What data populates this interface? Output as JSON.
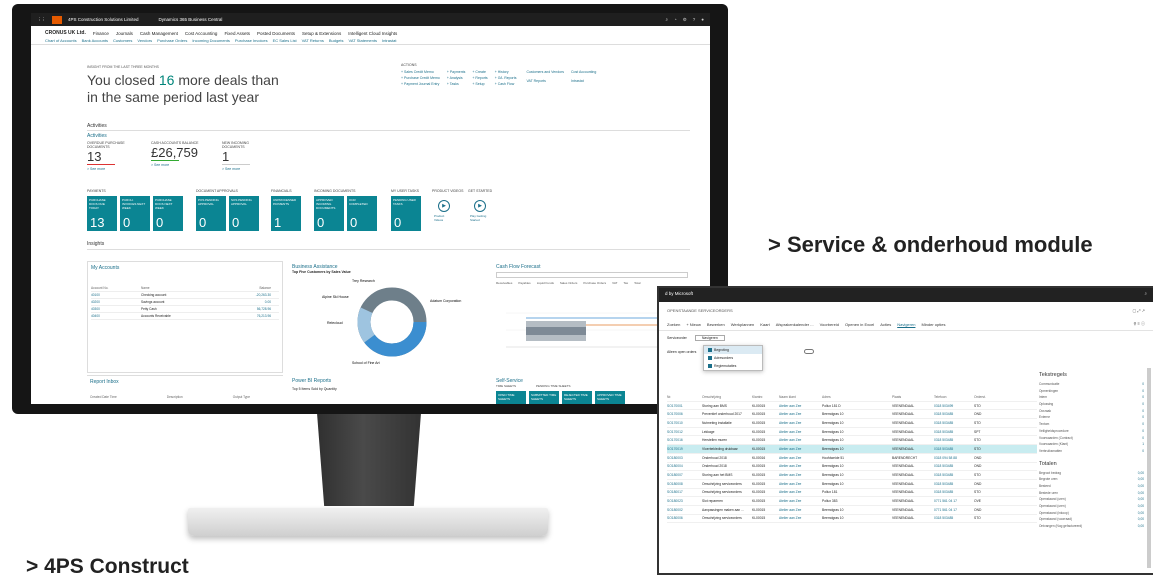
{
  "captions": {
    "service": "> Service & onderhoud module",
    "construct": "> 4PS Construct"
  },
  "bc": {
    "topbar": {
      "org": "4PS Construction Solutions Limited",
      "app_title": "Dynamics 365 Business Central",
      "icons": [
        "search-icon",
        "bell-icon",
        "gear-icon",
        "help-icon",
        "user-icon"
      ]
    },
    "company": "CRONUS UK Ltd.",
    "menu": [
      "Finance",
      "Journals",
      "Cash Management",
      "Cost Accounting",
      "Fixed Assets",
      "Posted Documents",
      "Setup & Extensions",
      "Intelligent Cloud Insights"
    ],
    "subnav": [
      "Chart of Accounts",
      "Bank Accounts",
      "Customers",
      "Vendors",
      "Purchase Orders",
      "Incoming Documents",
      "Purchase Invoices",
      "EC Sales List",
      "VAT Returns",
      "Budgets",
      "VAT Statements",
      "Intrastat"
    ],
    "headline": {
      "eyebrow": "INSIGHT FROM THE LAST THREE MONTHS",
      "pre": "You closed",
      "number": "16",
      "post": "more deals than in the same period last year"
    },
    "actions": {
      "label": "ACTIONS",
      "items": [
        "+ Sales Credit Memo",
        "+ Payments",
        "+ Create",
        "+ History",
        "+ Purchase Credit Memo",
        "+ Analysis",
        "+ Reports",
        "+ G/L Reports",
        "+ Payment Journal Entry",
        "+ Tasks",
        "+ Setup",
        "+ Cash Flow"
      ],
      "links": [
        "Customers and Vendors",
        "Cost Accounting",
        "VAT Reports",
        "Intrastat"
      ]
    },
    "activities": {
      "section": "Activities",
      "group": "Activities",
      "cues": [
        {
          "label": "OVERDUE PURCHASE DOCUMENTS",
          "value": "13",
          "link": "> See more"
        },
        {
          "label": "CASH ACCOUNTS BALANCE",
          "value": "£26,759",
          "link": "> See more"
        },
        {
          "label": "NEW INCOMING DOCUMENTS",
          "value": "1",
          "link": "> See more"
        }
      ]
    },
    "tile_groups": [
      {
        "label": "PAYMENTS",
        "tiles": [
          {
            "label": "PURCHASE DOCS DUE TODAY",
            "value": "13"
          },
          {
            "label": "PURCH. INVOICES NEXT WEEK",
            "value": "0"
          },
          {
            "label": "PURCHASE DOCS NEXT WEEK",
            "value": "0"
          }
        ]
      },
      {
        "label": "DOCUMENT APPROVALS",
        "tiles": [
          {
            "label": "POS PENDING APPROVAL",
            "value": "0"
          },
          {
            "label": "SOS PENDING APPROVAL",
            "value": "0"
          }
        ]
      },
      {
        "label": "FINANCIALS",
        "tiles": [
          {
            "label": "UNPROCESSED PAYMENTS",
            "value": "1"
          }
        ]
      },
      {
        "label": "INCOMING DOCUMENTS",
        "tiles": [
          {
            "label": "APPROVED INCOMING DOCUMENTS",
            "value": "0"
          },
          {
            "label": "OCR COMPLETED",
            "value": "0"
          }
        ]
      },
      {
        "label": "MY USER TASKS",
        "tiles": [
          {
            "label": "PENDING USER TASKS",
            "value": "0"
          }
        ]
      }
    ],
    "videos": {
      "label": "PRODUCT VIDEOS",
      "tile": "Product Videos"
    },
    "get_started": {
      "label": "GET STARTED",
      "tile": "Play Getting Started"
    },
    "insights": "Insights",
    "my_accounts": {
      "title": "My Accounts",
      "headers": [
        "Account No.",
        "Name",
        "Balance"
      ],
      "rows": [
        [
          "40100",
          "Checking account",
          "-20,263.30"
        ],
        [
          "40200",
          "Savings account",
          "0.00"
        ],
        [
          "40300",
          "Petty Cash",
          "56,728.96"
        ],
        [
          "40400",
          "Accounts Receivable",
          "76,213.96"
        ]
      ]
    },
    "business_assistance": {
      "title": "Business Assistance",
      "subtitle": "Top Five Customers by Sales Value",
      "labels": [
        "Trey Research",
        "Adatum Corporation",
        "Alpine Ski House",
        "Relecloud",
        "School of Fine Art"
      ]
    },
    "cash_flow": {
      "title": "Cash Flow Forecast",
      "legend": [
        "Receivables",
        "Payables",
        "Liquid Funds",
        "Sales Orders",
        "Purchase Orders",
        "VAT",
        "Tax",
        "Total"
      ]
    },
    "report_inbox": {
      "title": "Report Inbox",
      "headers": [
        "Created Date Time",
        "Description",
        "Output Type"
      ]
    },
    "power_bi": {
      "title": "Power BI Reports",
      "subtitle": "Top 5 Items Sold by Quantity"
    },
    "self_service": {
      "title": "Self-Service",
      "labels": [
        "TIME SHEETS",
        "PENDING TIME SHEETS"
      ],
      "tiles": [
        {
          "label": "OPEN TIME SHEETS",
          "value": "0"
        },
        {
          "label": "SUBMITTED TIME SHEETS",
          "value": "0"
        },
        {
          "label": "REJECTED TIME SHEETS",
          "value": "0"
        },
        {
          "label": "APPROVED TIME SHEETS",
          "value": "0"
        }
      ]
    }
  },
  "service": {
    "topbar": "d by Microsoft",
    "title": "OPENSTAANDE SERVICEORDERS",
    "toolbar": [
      "Zoeken",
      "+ Nieuw",
      "Bewerken",
      "Werkplannen",
      "Kaart",
      "Afsprakenkalender ...",
      "Voorbereid",
      "Openen in Excel",
      "Acties",
      "Navigeren",
      "Minder opties"
    ],
    "filter_label": "Serviceorder",
    "filter_value": "Navigeren",
    "filter2": "Alleen open orders",
    "dropdown": [
      "Begroting",
      "Adresorders",
      "Regiemutaties"
    ],
    "headers": [
      "Nr.",
      "Omschrijving",
      "Klantnr.",
      "Naam klant",
      "Adres",
      "Plaats",
      "Telefoon",
      "Orderst."
    ],
    "rows": [
      [
        "SO170001",
        "Storing aan BMS",
        "KL00015",
        "Atelier aan Zee",
        "Pollux 181 D",
        "VEENENDAAL",
        "0318 503499",
        "STO"
      ],
      [
        "SO170006",
        "Preventief onderhoud 2017",
        "KL00015",
        "Atelier aan Zee",
        "Beemdgras 10",
        "VEENENDAAL",
        "0318 503485",
        "OND"
      ],
      [
        "SO170010",
        "Nutmeting installatie",
        "KL00015",
        "Atelier aan Zee",
        "Beemdgras 10",
        "VEENENDAAL",
        "0318 503485",
        "STO"
      ],
      [
        "SO170012",
        "Lekkage",
        "KL00015",
        "Atelier aan Zee",
        "Beemdgras 10",
        "VEENENDAAL",
        "0318 503485",
        "SPT"
      ],
      [
        "SO170016",
        "Herstellen muren",
        "KL00015",
        "Atelier aan Zee",
        "Beemdgras 10",
        "VEENENDAAL",
        "0318 503485",
        "STO"
      ],
      [
        "SO170019",
        "Vloerbekleding drukbaar",
        "KL00015",
        "Atelier aan Zee",
        "Beemdgras 10",
        "VEENENDAAL",
        "0318 503485",
        "STO"
      ],
      [
        "SO180003",
        "Onderhoud 2018",
        "KL00016",
        "Atelier aan Zee",
        "Hoofdweide 51",
        "BARENDRECHT",
        "0318 094 58 88",
        "OND"
      ],
      [
        "SO180004",
        "Onderhoud 2018",
        "KL00015",
        "Atelier aan Zee",
        "Beemdgras 10",
        "VEENENDAAL",
        "0318 503485",
        "OND"
      ],
      [
        "SO180007",
        "Storing aan het BMS",
        "KL00015",
        "Atelier aan Zee",
        "Beemdgras 10",
        "VEENENDAAL",
        "0318 503485",
        "STO"
      ],
      [
        "SO180008",
        "Omschrijving serviceorders",
        "KL00015",
        "Atelier aan Zee",
        "Beemdgras 10",
        "VEENENDAAL",
        "0318 503485",
        "OND"
      ],
      [
        "SO180017",
        "Omschrijving serviceorders",
        "KL00015",
        "Atelier aan Zee",
        "Pollux 181",
        "VEENENDAAL",
        "0318 503485",
        "STO"
      ],
      [
        "SO180023",
        "Slot repareren",
        "KL00015",
        "Atelier aan Zee",
        "Pollux 383",
        "VEENENDAAL",
        "0771 561 04 17",
        "OVE"
      ],
      [
        "SO180002",
        "Aanpassingen maken aan ...",
        "KL00015",
        "Atelier aan Zee",
        "Beemdgras 10",
        "VEENENDAAL",
        "0771 561 04 17",
        "OND"
      ],
      [
        "SO180006",
        "Omschrijving serviceorders",
        "KL00015",
        "Atelier aan Zee",
        "Beemdgras 10",
        "VEENENDAAL",
        "0318 503485",
        "STO"
      ]
    ],
    "highlighted_row": 5,
    "factbox": {
      "title1": "Tekstregels",
      "rows1": [
        [
          "Communicatie",
          "0"
        ],
        [
          "Opmerkingen",
          "0"
        ],
        [
          "Intern",
          "0"
        ],
        [
          "Oplossing",
          "0"
        ],
        [
          "Oorzaak",
          "0"
        ],
        [
          "Externe",
          "0"
        ],
        [
          "Textom",
          "0"
        ],
        [
          "Veiligheidsprocedure",
          "0"
        ],
        [
          "Voorwaarden (Contract)",
          "0"
        ],
        [
          "Voorwaarden (Klant)",
          "1"
        ],
        [
          "Verbruiksmatten",
          "0"
        ]
      ],
      "title2": "Totalen",
      "rows2": [
        [
          "Begroot bedrag",
          "0,00"
        ],
        [
          "Begrote uren",
          "0,00"
        ],
        [
          "Besteed",
          "0,00"
        ],
        [
          "Bestede uren",
          "0,00"
        ],
        [
          "Openstaand (uren)",
          "0,00"
        ],
        [
          "Openstaand (uren)",
          "0,00"
        ],
        [
          "Openstaand (inkoop)",
          "0,00"
        ],
        [
          "Openstaand (voorraad)",
          "0,00"
        ],
        [
          "Ontvangen (Nog gefactureerd)",
          "0,00"
        ]
      ]
    }
  }
}
